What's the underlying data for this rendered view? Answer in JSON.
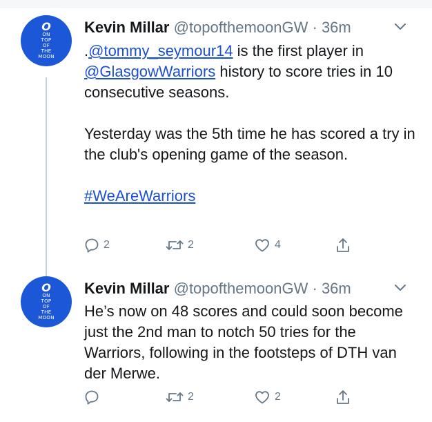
{
  "tweets": [
    {
      "avatar": {
        "mark": "O",
        "lines": [
          "ON",
          "TOP",
          "OF",
          "THE",
          "MOON"
        ]
      },
      "author_name": "Kevin Millar",
      "handle": "@topofthemoonGW",
      "separator": " · ",
      "time": "36m",
      "text": {
        "lead": ".",
        "mention1": "@tommy_seymour14",
        "mid": " is the first player in ",
        "mention2": "@GlasgowWarriors",
        "tail": " history to score tries in 10 consecutive seasons.",
        "para2": "Yesterday was the 5th time he has scored a try in the club's opening game of the season.",
        "hashtag": "#WeAreWarriors"
      },
      "counts": {
        "replies": "2",
        "retweets": "2",
        "likes": "4"
      }
    },
    {
      "avatar": {
        "mark": "O",
        "lines": [
          "ON",
          "TOP",
          "OF",
          "THE",
          "MOON"
        ]
      },
      "author_name": "Kevin Millar",
      "handle": "@topofthemoonGW",
      "separator": " · ",
      "time": "36m",
      "text": {
        "para1": "He’s now on 48 scores and could soon become just the 2nd man to notch 50 tries for the Warriors, following in the footsteps of DTH van der Merwe."
      },
      "counts": {
        "replies": "",
        "retweets": "2",
        "likes": "2"
      }
    }
  ],
  "icons": {
    "reply": "reply-icon",
    "retweet": "retweet-icon",
    "like": "heart-icon",
    "share": "share-icon",
    "more": "chevron-down-icon"
  },
  "colors": {
    "link": "#1b4fd1",
    "muted": "#657786",
    "avatar_bg": "#1c57d8"
  }
}
